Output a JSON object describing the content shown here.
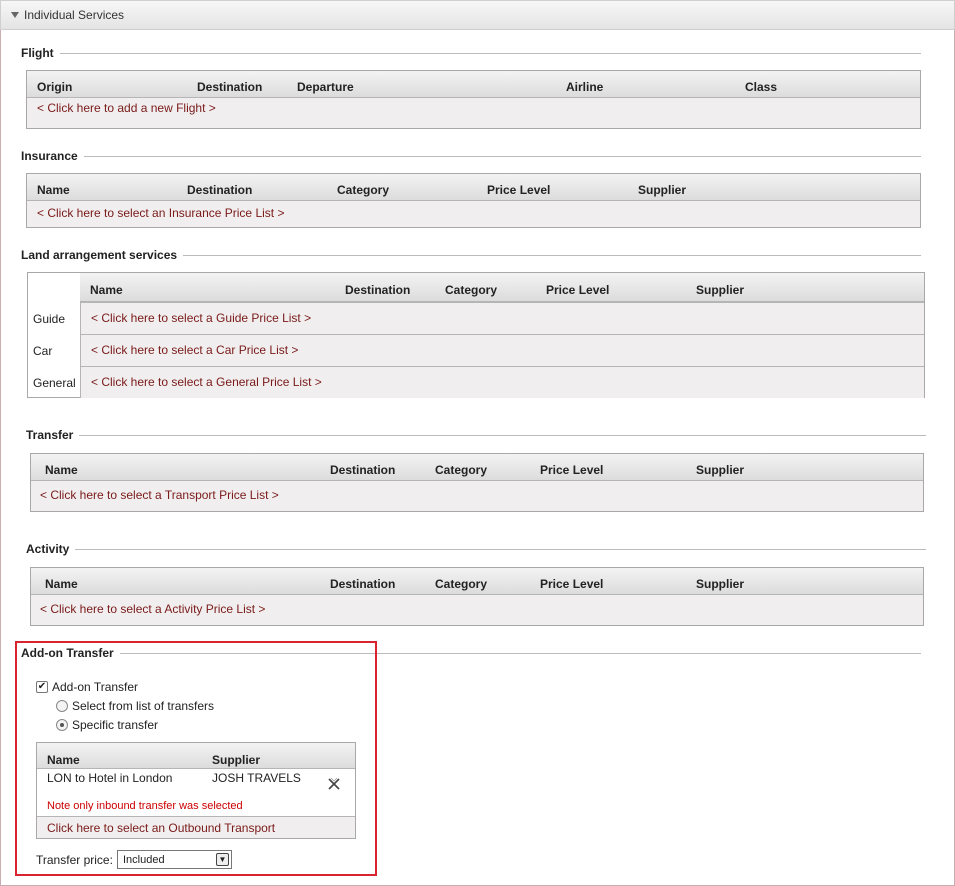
{
  "panel": {
    "title": "Individual Services"
  },
  "flight": {
    "title": "Flight",
    "columns": [
      "Origin",
      "Destination",
      "Departure",
      "Airline",
      "Class"
    ],
    "add_link": "< Click here to add a new Flight >"
  },
  "insurance": {
    "title": "Insurance",
    "columns": [
      "Name",
      "Destination",
      "Category",
      "Price Level",
      "Supplier"
    ],
    "add_link": "< Click here to select an Insurance Price List >"
  },
  "land": {
    "title": "Land arrangement services",
    "columns": [
      "Name",
      "Destination",
      "Category",
      "Price Level",
      "Supplier"
    ],
    "rows": [
      {
        "label": "Guide",
        "link": "< Click here to select a Guide Price List >"
      },
      {
        "label": "Car",
        "link": "< Click here to select a Car Price List >"
      },
      {
        "label": "General",
        "link": "< Click here to select a General Price List >"
      }
    ]
  },
  "transfer": {
    "title": "Transfer",
    "columns": [
      "Name",
      "Destination",
      "Category",
      "Price Level",
      "Supplier"
    ],
    "add_link": "< Click here to select a Transport Price List >"
  },
  "activity": {
    "title": "Activity",
    "columns": [
      "Name",
      "Destination",
      "Category",
      "Price Level",
      "Supplier"
    ],
    "add_link": "< Click here to select a Activity Price List >"
  },
  "addon": {
    "title": "Add-on Transfer",
    "checkbox_label": "Add-on Transfer",
    "checked": true,
    "radio_list": "Select from list of transfers",
    "radio_specific": "Specific transfer",
    "selected_option": "specific",
    "columns": [
      "Name",
      "Supplier"
    ],
    "row": {
      "name": "LON to Hotel in London",
      "supplier": "JOSH TRAVELS"
    },
    "note": "Note only inbound transfer was selected",
    "outbound_link": "Click here to select an Outbound Transport",
    "price_label": "Transfer price:",
    "price_value": "Included"
  },
  "colors": {
    "accent_red": "#d9232e",
    "link": "#7a1a1a",
    "note": "#cc0000"
  }
}
